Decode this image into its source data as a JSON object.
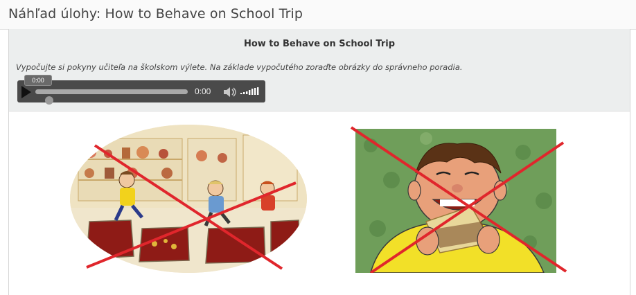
{
  "page": {
    "title": "Náhľad úlohy: How to Behave on School Trip"
  },
  "task": {
    "title": "How to Behave on School Trip",
    "instructions": "Vypočujte si pokyny učiteľa na školskom výlete. Na základe vypočutého zoraďte obrázky do správneho poradia."
  },
  "audio_player": {
    "scrub_time": "0:00",
    "current_time": "0:00",
    "progress": 0.0,
    "volume": 1.0,
    "icons": [
      "play-icon",
      "volume-icon",
      "volume-level-icon"
    ]
  },
  "images": [
    {
      "name": "museum-running-kids",
      "crossed_out": true
    },
    {
      "name": "boy-eating-sandwich",
      "crossed_out": true
    }
  ],
  "colors": {
    "cross": "#e0262c",
    "panel": "#eceeee",
    "player": "#4a4a4a"
  }
}
